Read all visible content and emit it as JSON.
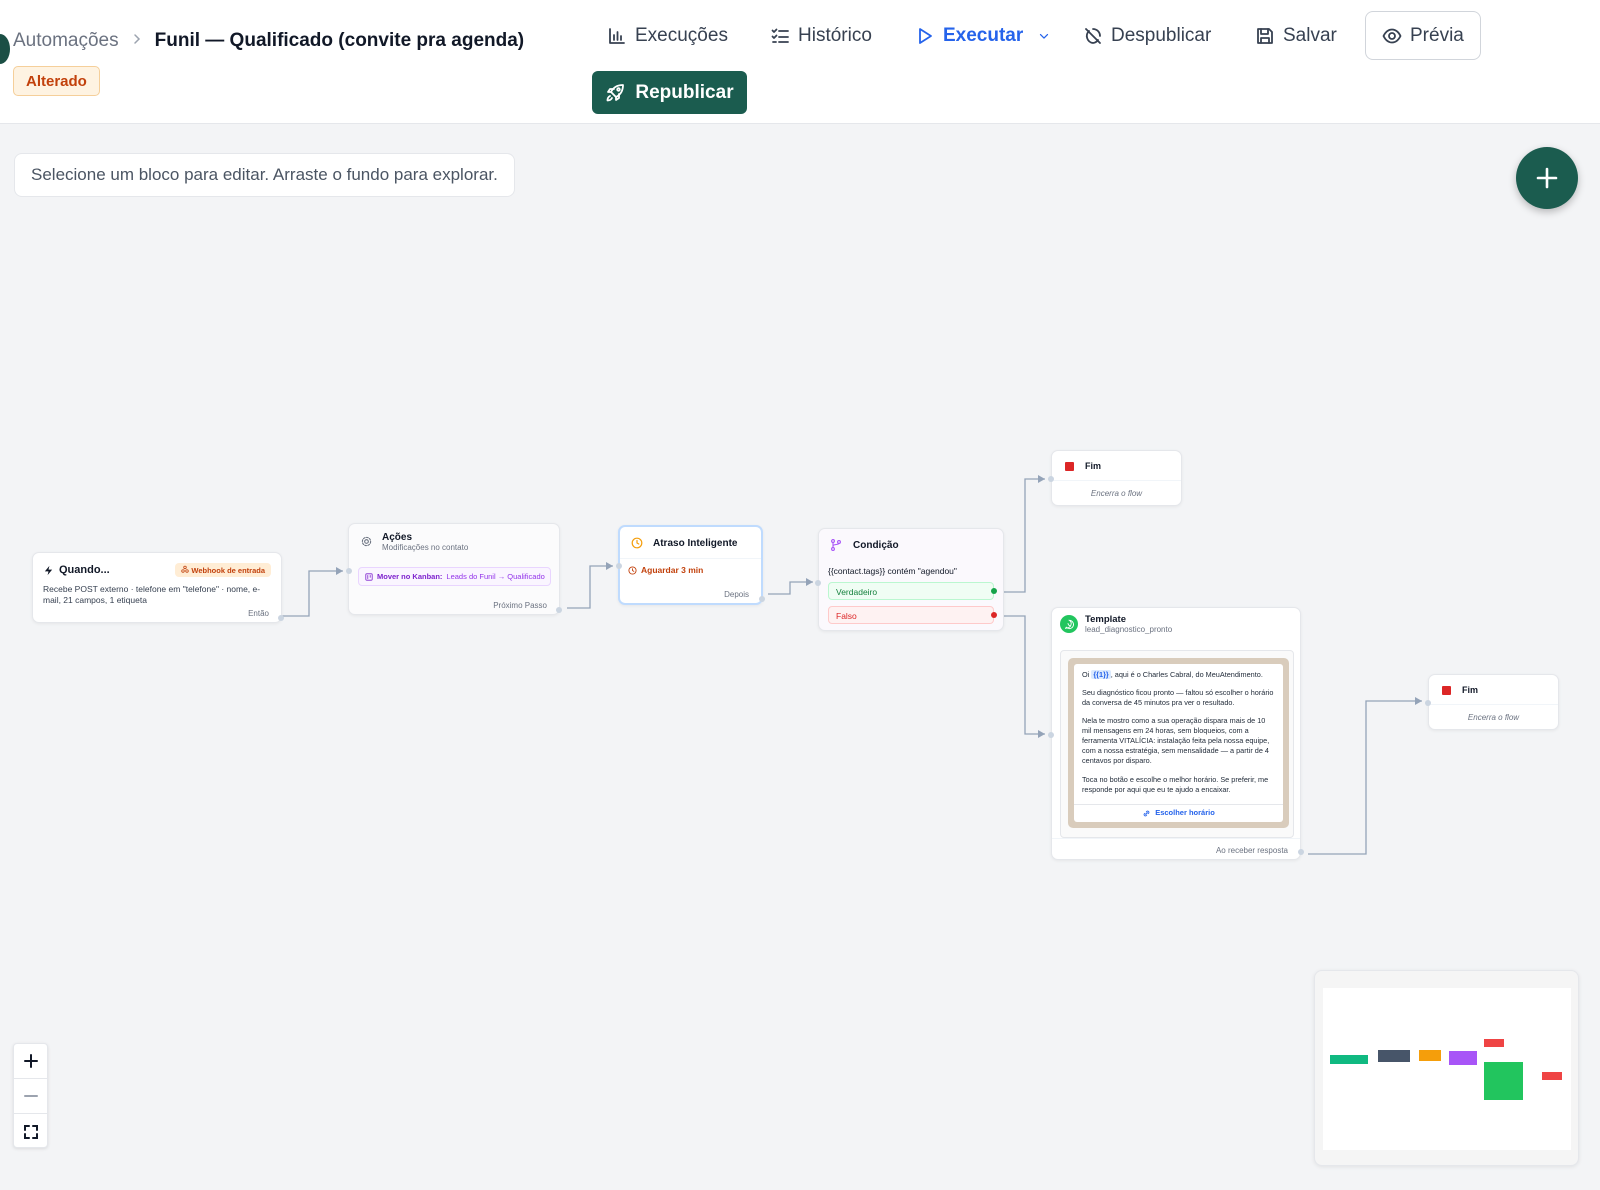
{
  "header": {
    "breadcrumb_parent": "Automações",
    "title": "Funil — Qualificado (convite pra agenda)",
    "status_badge": "Alterado",
    "toolbar": {
      "executions": "Execuções",
      "history": "Histórico",
      "execute": "Executar",
      "unpublish": "Despublicar",
      "save": "Salvar",
      "preview": "Prévia",
      "republish": "Republicar"
    }
  },
  "canvas": {
    "hint": "Selecione um bloco para editar. Arraste o fundo para explorar."
  },
  "nodes": {
    "trigger": {
      "title": "Quando...",
      "badge": "Webhook de entrada",
      "description": "Recebe POST externo · telefone em \"telefone\" · nome, e-mail, 21 campos, 1 etiqueta",
      "footer": "Então"
    },
    "actions": {
      "title": "Ações",
      "subtitle": "Modificações no contato",
      "action_label": "Mover no Kanban:",
      "action_value": "Leads do Funil → Qualificado",
      "footer": "Próximo Passo"
    },
    "delay": {
      "title": "Atraso Inteligente",
      "wait": "Aguardar 3 min",
      "footer": "Depois"
    },
    "condition": {
      "title": "Condição",
      "expression": "{{contact.tags}} contém \"agendou\"",
      "true_label": "Verdadeiro",
      "false_label": "Falso"
    },
    "end_top": {
      "title": "Fim",
      "subtitle": "Encerra o flow"
    },
    "template": {
      "title": "Template",
      "subtitle": "lead_diagnostico_pronto",
      "greeting_before": "Oi ",
      "greeting_var": "{{1}}",
      "greeting_after": ", aqui é o Charles Cabral, do MeuAtendimento.",
      "paragraph_2": "Seu diagnóstico ficou pronto — faltou só escolher o horário da conversa de 45 minutos pra ver o resultado.",
      "paragraph_3": "Nela te mostro como a sua operação dispara mais de 10 mil mensagens em 24 horas, sem bloqueios, com a ferramenta VITALÍCIA: instalação feita pela nossa equipe, com a nossa estratégia, sem mensalidade — a partir de 4 centavos por disparo.",
      "paragraph_4": "Toca no botão e escolhe o melhor horário. Se preferir, me responde por aqui que eu te ajudo a encaixar.",
      "button": "Escolher horário",
      "footer": "Ao receber resposta"
    },
    "end_right": {
      "title": "Fim",
      "subtitle": "Encerra o flow"
    }
  },
  "colors": {
    "brand": "#1b5c4f",
    "execute_blue": "#2563eb",
    "true_green": "#16a34a",
    "false_red": "#dc2626",
    "end_red": "#dc2626",
    "whatsapp_green": "#22c55e"
  },
  "minimap": {
    "node_colors": [
      "#10b981",
      "#475569",
      "#f59e0b",
      "#a855f7",
      "#ef4444",
      "#22c55e",
      "#ef4444"
    ]
  }
}
